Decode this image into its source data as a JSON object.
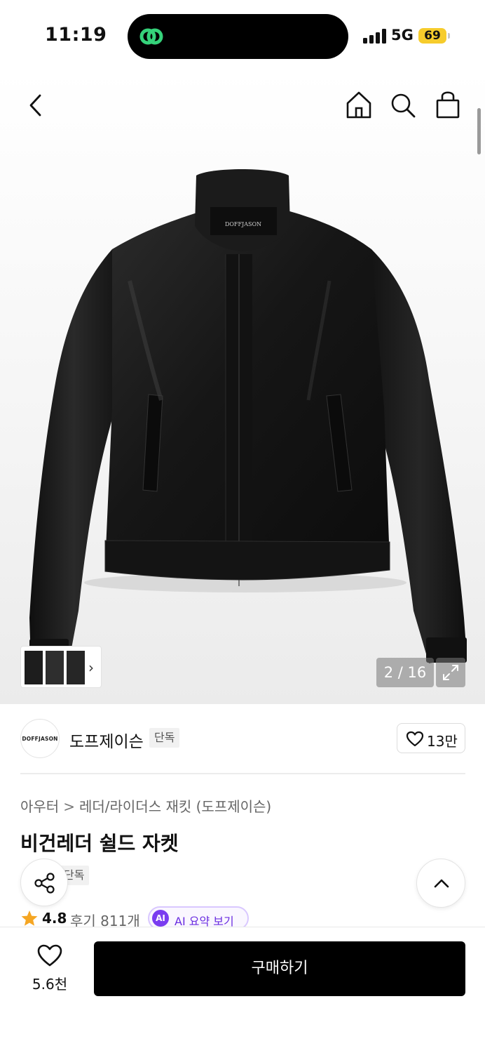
{
  "status_bar": {
    "time": "11:19",
    "network": "5G",
    "battery": "69",
    "battery_color": "#f6cc2c",
    "signal_icon": "signal-bars-icon",
    "island_icon": "link-app-icon"
  },
  "header": {
    "back_icon": "chevron-left-icon",
    "home_icon": "home-icon",
    "search_icon": "search-icon",
    "cart_icon": "shopping-bag-icon"
  },
  "gallery": {
    "current": 2,
    "total": 16,
    "counter_label": "2 / 16",
    "expand_icon": "expand-icon",
    "thumb_chevron": "›",
    "image_logo_text": "DOFFJASON"
  },
  "brand": {
    "logo_text": "DOFFJASON",
    "name": "도프제이슨",
    "badge": "단독",
    "favorite_count": "13만",
    "favorite_icon": "heart-outline-icon"
  },
  "product": {
    "breadcrumb": [
      "아우터",
      "레더/라이더스 재킷 (도프제이슨)"
    ],
    "breadcrumb_sep": ">",
    "title": "비건레더 쉴드 자켓",
    "badge": "단독",
    "rating": "4.8",
    "reviews_label": "후기 811개",
    "ai_badge": "AI",
    "ai_summary_label": "AI 요약 보기",
    "star_color": "#f5a623",
    "ai_color": "#7a3cf0"
  },
  "floating": {
    "share_icon": "share-icon",
    "scroll_top_icon": "chevron-up-icon"
  },
  "bottom_bar": {
    "like_count": "5.6천",
    "like_icon": "heart-outline-icon",
    "buy_label": "구매하기"
  }
}
